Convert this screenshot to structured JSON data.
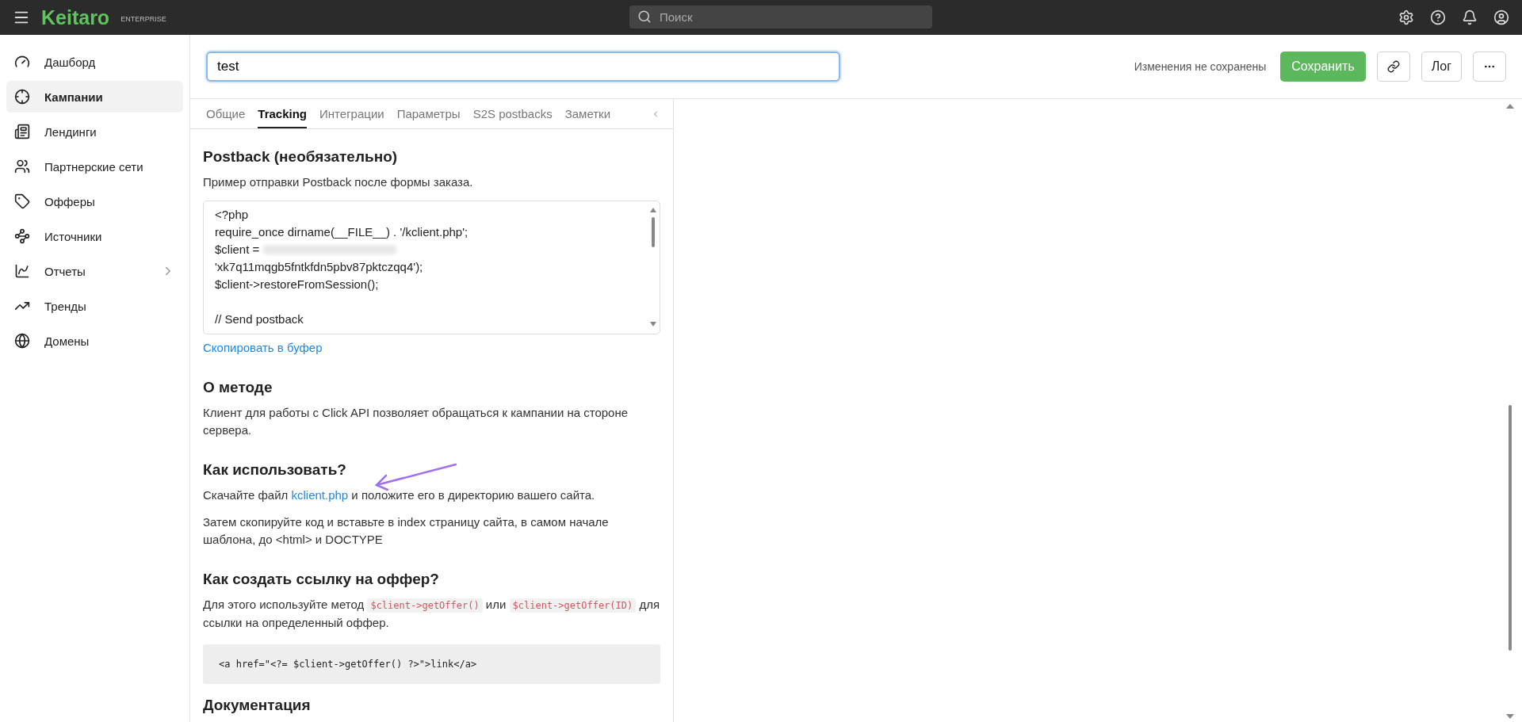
{
  "topbar": {
    "logo": "Keitaro",
    "edition": "ENTERPRISE",
    "search": {
      "placeholder": "Поиск"
    }
  },
  "sidebar": {
    "items": [
      {
        "label": "Дашборд",
        "selected": false,
        "expandable": false
      },
      {
        "label": "Кампании",
        "selected": true,
        "expandable": false
      },
      {
        "label": "Лендинги",
        "selected": false,
        "expandable": false
      },
      {
        "label": "Партнерские сети",
        "selected": false,
        "expandable": false
      },
      {
        "label": "Офферы",
        "selected": false,
        "expandable": false
      },
      {
        "label": "Источники",
        "selected": false,
        "expandable": false
      },
      {
        "label": "Отчеты",
        "selected": false,
        "expandable": true
      },
      {
        "label": "Тренды",
        "selected": false,
        "expandable": false
      },
      {
        "label": "Домены",
        "selected": false,
        "expandable": false
      }
    ]
  },
  "header": {
    "name": "test",
    "status": "Изменения не сохранены",
    "save": "Сохранить",
    "log": "Лог"
  },
  "tabs": [
    {
      "label": "Общие",
      "selected": false
    },
    {
      "label": "Tracking",
      "selected": true
    },
    {
      "label": "Интеграции",
      "selected": false
    },
    {
      "label": "Параметры",
      "selected": false
    },
    {
      "label": "S2S postbacks",
      "selected": false
    },
    {
      "label": "Заметки",
      "selected": false
    }
  ],
  "content": [
    {
      "kind": "heading",
      "text": "Postback (необязательно)",
      "arrow": false
    },
    {
      "kind": "paragraph",
      "parts": [
        {
          "kind": "text",
          "text": "Пример отправки Postback после формы заказа."
        }
      ]
    },
    {
      "kind": "code_box",
      "lines": [
        {
          "kind": "code",
          "text": "<?php"
        },
        {
          "kind": "code",
          "text": "require_once dirname(__FILE__) . '/kclient.php';"
        },
        {
          "kind": "code",
          "text": "$client = ",
          "redacted": true
        },
        {
          "kind": "code",
          "text": "'xk7q11mqgb5fntkfdn5pbv87pktczqq4');"
        },
        {
          "kind": "code",
          "text": "$client->restoreFromSession();"
        },
        {
          "kind": "blank"
        },
        {
          "kind": "code",
          "text": "// Send postback"
        }
      ]
    },
    {
      "kind": "action",
      "text": "Скопировать в буфер"
    },
    {
      "kind": "heading",
      "text": "О методе",
      "arrow": false
    },
    {
      "kind": "paragraph",
      "parts": [
        {
          "kind": "text",
          "text": "Клиент для работы с Click API позволяет обращаться к кампании на стороне сервера."
        }
      ]
    },
    {
      "kind": "heading",
      "text": "Как использовать?",
      "arrow": true
    },
    {
      "kind": "paragraph",
      "parts": [
        {
          "kind": "text",
          "text": "Скачайте файл "
        },
        {
          "kind": "link",
          "text": "kclient.php"
        },
        {
          "kind": "text",
          "text": " и положите его в директорию вашего сайта."
        }
      ]
    },
    {
      "kind": "paragraph",
      "parts": [
        {
          "kind": "text",
          "text": "Затем скопируйте код и вставьте в index страницу сайта, в самом начале шаблона, до <html> и DOCTYPE"
        }
      ]
    },
    {
      "kind": "heading",
      "text": "Как создать ссылку на оффер?",
      "arrow": false
    },
    {
      "kind": "paragraph",
      "parts": [
        {
          "kind": "text",
          "text": "Для этого используйте метод "
        },
        {
          "kind": "code",
          "text": "$client->getOffer()"
        },
        {
          "kind": "text",
          "text": " или "
        },
        {
          "kind": "code",
          "text": "$client->getOffer(ID)"
        },
        {
          "kind": "text",
          "text": " для ссылки на определенный оффер."
        }
      ]
    },
    {
      "kind": "pre",
      "text": "<a href=\"<?= $client->getOffer() ?>\">link</a>"
    },
    {
      "kind": "heading",
      "text": "Документация",
      "arrow": false
    }
  ]
}
